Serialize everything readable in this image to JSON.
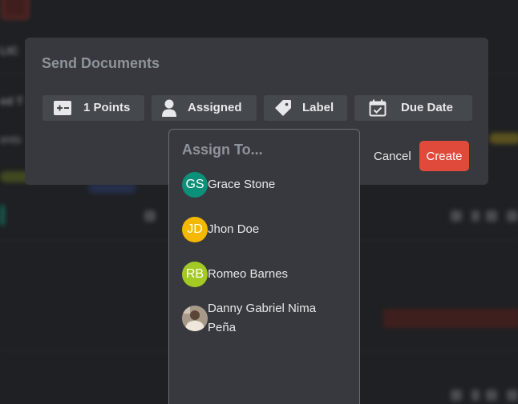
{
  "background": {
    "texts": [
      "LIC",
      "ed T",
      "ents"
    ]
  },
  "modal": {
    "title": "Send Documents",
    "toolbar": {
      "points_label": "1 Points",
      "assigned_label": "Assigned",
      "label_label": "Label",
      "due_date_label": "Due Date"
    },
    "cancel_label": "Cancel",
    "create_label": "Create"
  },
  "dropdown": {
    "title": "Assign To...",
    "users": [
      {
        "initials": "GS",
        "name": "Grace Stone",
        "color": "#0b9079"
      },
      {
        "initials": "JD",
        "name": "Jhon Doe",
        "color": "#f5b800"
      },
      {
        "initials": "RB",
        "name": "Romeo Barnes",
        "color": "#a4c925"
      },
      {
        "initials": "",
        "name": "Danny Gabriel Nima Peña",
        "color": "#8a7a6a"
      }
    ]
  },
  "colors": {
    "accent": "#e04a3a",
    "modal_bg": "#37393e",
    "button_bg": "#45484d"
  }
}
